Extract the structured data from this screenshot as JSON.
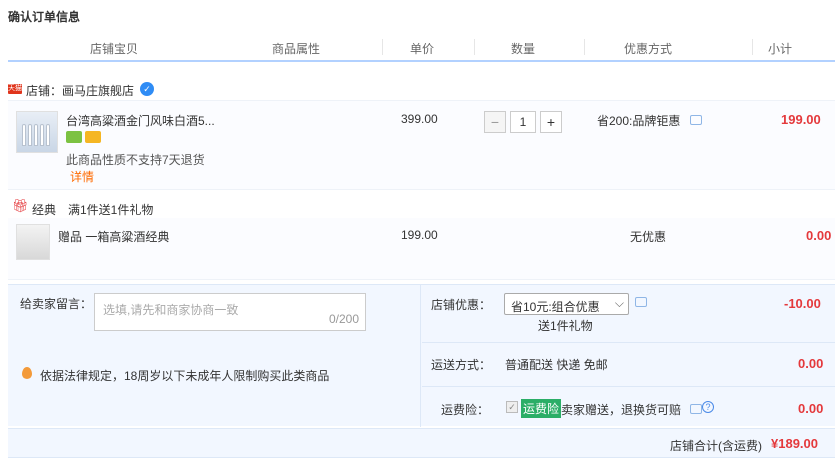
{
  "page": {
    "title": "确认订单信息"
  },
  "columns": [
    "店铺宝贝",
    "商品属性",
    "单价",
    "数量",
    "优惠方式",
    "小计"
  ],
  "shop": {
    "badge": "天猫",
    "label": "店铺：画马庄旗舰店"
  },
  "item": {
    "name": "台湾高粱酒金门风味白酒5...",
    "notice": "此商品性质不支持7天退货",
    "detail_link": "详情",
    "unit_price": "399.00",
    "quantity": "1",
    "promotion": "省200:品牌钜惠",
    "subtotal": "199.00"
  },
  "gift_section": {
    "label": "经典",
    "rule": "满1件送1件礼物"
  },
  "gift": {
    "name": "赠品 一箱高粱酒经典",
    "unit_price": "199.00",
    "promotion": "无优惠",
    "subtotal": "0.00"
  },
  "message": {
    "label": "给卖家留言：",
    "placeholder": "选填,请先和商家协商一致",
    "counter": "0/200"
  },
  "law_notice": "依据法律规定，18周岁以下未成年人限制购买此类商品",
  "shop_coupon": {
    "label": "店铺优惠：",
    "selected": "省10元:组合优惠",
    "sub": "送1件礼物",
    "amount": "-10.00"
  },
  "shipping": {
    "label": "运送方式：",
    "value": "普通配送 快递 免邮",
    "amount": "0.00"
  },
  "insurance": {
    "label": "运费险：",
    "tag": "运费险",
    "text": "卖家赠送，退换货可赔",
    "amount": "0.00"
  },
  "total": {
    "label": "店铺合计(含运费)",
    "value": "¥189.00"
  },
  "colors": {
    "accent_red": "#e4393c",
    "header_line": "#b2d1ff",
    "panel_bg": "#f2f7ff",
    "tag_green": "#2bae67"
  }
}
